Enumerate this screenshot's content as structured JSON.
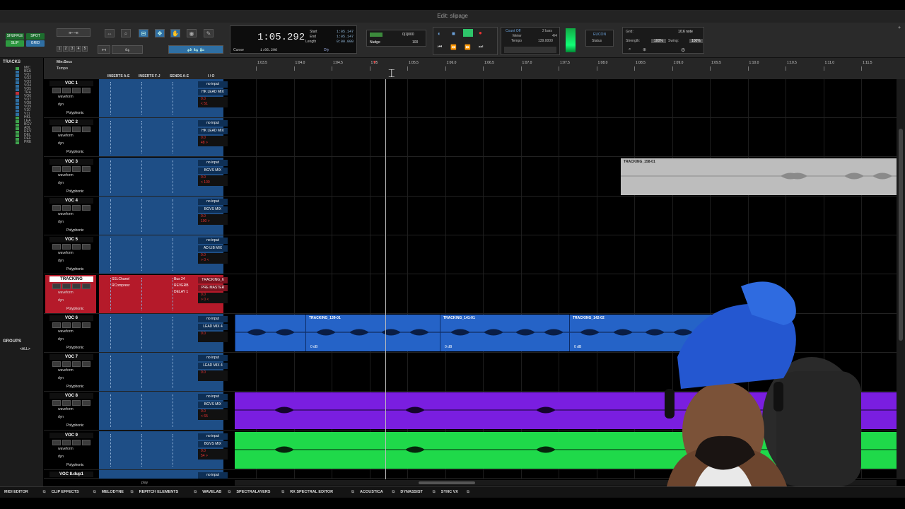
{
  "window": {
    "title": "Edit: slipage"
  },
  "modes": {
    "shuffle": "SHUFFLE",
    "spot": "SPOT",
    "slip": "SLIP",
    "grid": "GRID"
  },
  "zoom_presets": [
    "1",
    "2",
    "3",
    "4",
    "5"
  ],
  "counter": {
    "main": "1:05.292",
    "start_label": "Start",
    "start": "1:05.147",
    "end_label": "End",
    "end": "1:05.147",
    "length_label": "Length",
    "length": "0:00.000",
    "cursor_label": "Cursor",
    "cursor": "1:05.296",
    "dly_label": "Dly"
  },
  "nudge": {
    "grid_value": "0|1|000",
    "nudge_label": "Nudge",
    "nudge_value": "100"
  },
  "transport": {
    "count_off": "Count Off",
    "count_off_value": "2 bars",
    "meter_label": "Meter",
    "meter_value": "4/4",
    "tempo_label": "Tempo",
    "tempo_value": "139.0000"
  },
  "eucon": {
    "label": "EUCON",
    "status": "Status"
  },
  "grid_panel": {
    "grid_label": "Grid:",
    "grid_value": "1/16 note",
    "strength_label": "Strength:",
    "strength_value": "100%",
    "swing_label": "Swing:",
    "swing_value": "100%"
  },
  "left_panel": {
    "tracks_title": "TRACKS",
    "tracks": [
      {
        "name": "MIC",
        "color": "#3fa34d"
      },
      {
        "name": "BEA",
        "color": "#2f6fa3"
      },
      {
        "name": "VO1",
        "color": "#2f6fa3"
      },
      {
        "name": "VO2",
        "color": "#2f6fa3"
      },
      {
        "name": "VO3",
        "color": "#2f6fa3"
      },
      {
        "name": "VO4",
        "color": "#2f6fa3"
      },
      {
        "name": "VO5",
        "color": "#2f6fa3"
      },
      {
        "name": "TRA",
        "color": "#c0303a"
      },
      {
        "name": "VO6",
        "color": "#2f6fa3"
      },
      {
        "name": "VO7",
        "color": "#2f6fa3"
      },
      {
        "name": "VO8",
        "color": "#2f6fa3"
      },
      {
        "name": "VO9",
        "color": "#2f6fa3"
      },
      {
        "name": "V10",
        "color": "#2f6fa3"
      },
      {
        "name": "V11",
        "color": "#2f6fa3"
      },
      {
        "name": "HKL",
        "color": "#3fa34d"
      },
      {
        "name": "LEA",
        "color": "#3fa34d"
      },
      {
        "name": "BGV",
        "color": "#3fa34d"
      },
      {
        "name": "ADL",
        "color": "#3fa34d"
      },
      {
        "name": "REV",
        "color": "#3fa34d"
      },
      {
        "name": "DEL",
        "color": "#3fa34d"
      },
      {
        "name": "DEF",
        "color": "#3fa34d"
      },
      {
        "name": "PRE",
        "color": "#3fa34d"
      }
    ],
    "groups_title": "GROUPS",
    "groups_item": "<ALL>"
  },
  "header": {
    "ruler_label": "Min:Secs",
    "tempo_label": "Tempo",
    "inserts_ae": "INSERTS A-E",
    "inserts_fj": "INSERTS F-J",
    "sends_ae": "SENDS A-E",
    "io": "I / O",
    "ticks": [
      "1:03.5",
      "1:04.0",
      "1:04.5",
      "1:05",
      "1:05.5",
      "1:06.0",
      "1:06.5",
      "1:07.0",
      "1:07.5",
      "1:08.0",
      "1:08.5",
      "1:09.0",
      "1:09.5",
      "1:10.0",
      "1:10.5",
      "1:11.0",
      "1:11.5"
    ]
  },
  "tracks": [
    {
      "name": "VOC 1",
      "input": "no input",
      "output": "HK LEAD MIX",
      "vol": "0.0",
      "pan": "< 51",
      "waveform": "waveform",
      "dyn": "dyn",
      "poly": "Polyphonic"
    },
    {
      "name": "VOC 2",
      "input": "no input",
      "output": "HK LEAD MIX",
      "vol": "0.0",
      "pan": "48 >",
      "waveform": "waveform",
      "dyn": "dyn",
      "poly": "Polyphonic"
    },
    {
      "name": "VOC 3",
      "input": "no input",
      "output": "BGVS MIX",
      "vol": "0.0",
      "pan": "< 100",
      "waveform": "waveform",
      "dyn": "dyn",
      "poly": "Polyphonic"
    },
    {
      "name": "VOC 4",
      "input": "no input",
      "output": "BGVS MIX",
      "vol": "0.0",
      "pan": "100 >",
      "waveform": "waveform",
      "dyn": "dyn",
      "poly": "Polyphonic"
    },
    {
      "name": "VOC 5",
      "input": "no input",
      "output": "AD LIB MIX",
      "vol": "0.0",
      "pan": "> 0 <",
      "waveform": "waveform",
      "dyn": "dyn",
      "poly": "Polyphonic"
    },
    {
      "name": "TRACKING",
      "input": "Bus 24",
      "output": "PRE MASTER",
      "vol": "0.0",
      "pan": "> 0 <",
      "waveform": "waveform",
      "dyn": "dyn",
      "poly": "Polyphonic",
      "inserts": [
        "SSLChanel",
        "RCompresr"
      ],
      "sends": [
        "REVERB",
        "DELAY 1"
      ],
      "top_io": "TRACKING_6"
    },
    {
      "name": "VOC 6",
      "input": "no input",
      "output": "LEAD MIX 4",
      "vol": "0.0",
      "pan": "",
      "waveform": "waveform",
      "dyn": "dyn",
      "poly": "Polyphonic"
    },
    {
      "name": "VOC 7",
      "input": "no input",
      "output": "LEAD MIX 4",
      "vol": "0.0",
      "pan": "",
      "waveform": "waveform",
      "dyn": "dyn",
      "poly": "Polyphonic"
    },
    {
      "name": "VOC 8",
      "input": "no input",
      "output": "BGVS MIX",
      "vol": "0.0",
      "pan": "< 65",
      "waveform": "waveform",
      "dyn": "dyn",
      "poly": "Polyphonic"
    },
    {
      "name": "VOC 9",
      "input": "no input",
      "output": "BGVS MIX",
      "vol": "0.0",
      "pan": "54 >",
      "waveform": "waveform",
      "dyn": "dyn",
      "poly": "Polyphonic"
    }
  ],
  "next_track": {
    "name": "VOC 8.dup1",
    "input": "no input"
  },
  "clips": {
    "voc3": {
      "name": "TRACKING_158-01"
    },
    "voc6": [
      {
        "name": "",
        "db": ""
      },
      {
        "name": "TRACKING_139-01",
        "db": "0 dB"
      },
      {
        "name": "TRACKING_141-01",
        "db": "0 dB"
      },
      {
        "name": "TRACKING_142-02",
        "db": "0 dB"
      }
    ]
  },
  "colors": {
    "blue": "#2563c7",
    "purple": "#7a1ee0",
    "green": "#1fd94a",
    "red": "#b51a2a",
    "gray": "#bdbdbd"
  },
  "play_label": "play",
  "bottom_bar": [
    "MIDI EDITOR",
    "CLIP EFFECTS",
    "MELODYNE",
    "REPITCH ELEMENTS",
    "WAVELAB",
    "SPECTRALAYERS",
    "RX SPECTRAL EDITOR",
    "ACOUSTICA",
    "DYNASSIST",
    "SYNC VX"
  ]
}
